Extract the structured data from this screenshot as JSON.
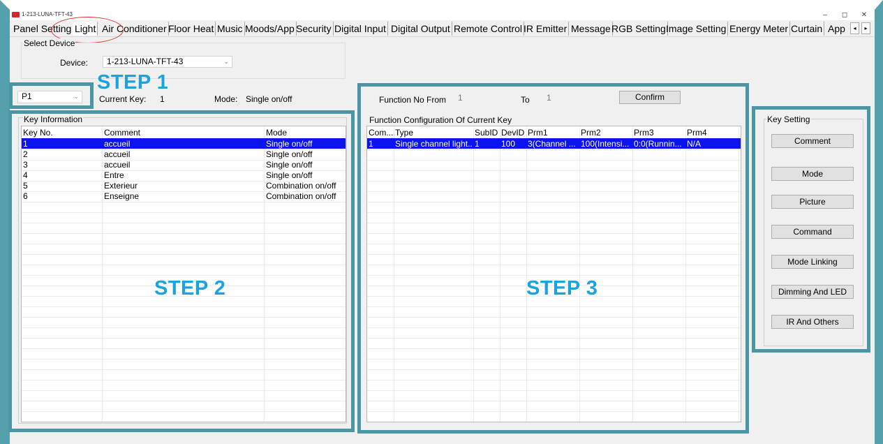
{
  "window": {
    "title": "1-213-LUNA-TFT-43",
    "minimize": "–",
    "maximize": "◻",
    "close": "✕"
  },
  "tabs": [
    "Panel Setting",
    "Light",
    "Air Conditioner",
    "Floor Heat",
    "Music",
    "Moods/App",
    "Security",
    "Digital Input",
    "Digital Output",
    "Remote Control",
    "IR Emitter",
    "Message",
    "RGB Setting",
    "Image Setting",
    "Energy Meter",
    "Curtain",
    "App"
  ],
  "tab_scroll": {
    "left": "◂",
    "right": "▸"
  },
  "select_device": {
    "group_label": "Select Device",
    "device_label": "Device:",
    "device_value": "1-213-LUNA-TFT-43"
  },
  "steps": {
    "step1": "STEP 1",
    "step2": "STEP 2",
    "step3": "STEP 3"
  },
  "page_select": {
    "value": "P1"
  },
  "current_key": {
    "label": "Current Key:",
    "value": "1"
  },
  "mode": {
    "label": "Mode:",
    "value": "Single on/off"
  },
  "key_info": {
    "title": "Key Information",
    "headers": [
      "Key No.",
      "Comment",
      "Mode"
    ],
    "rows": [
      [
        "1",
        "accueil",
        "Single on/off"
      ],
      [
        "2",
        "accueil",
        "Single on/off"
      ],
      [
        "3",
        "accueil",
        "Single on/off"
      ],
      [
        "4",
        "Entre",
        "Single on/off"
      ],
      [
        "5",
        "Exterieur",
        "Combination on/off"
      ],
      [
        "6",
        "Enseigne",
        "Combination on/off"
      ]
    ],
    "selected_row": 0
  },
  "function": {
    "from_label": "Function No From",
    "from_value": "1",
    "to_label": "To",
    "to_value": "1",
    "confirm": "Confirm",
    "config_title": "Function Configuration Of Current Key",
    "headers": [
      "Com...",
      "Type",
      "SubID",
      "DevID",
      "Prm1",
      "Prm2",
      "Prm3",
      "Prm4"
    ],
    "rows": [
      [
        "1",
        "Single channel light...",
        "1",
        "100",
        "3(Channel ...",
        "100(Intensi...",
        "0:0(Runnin...",
        "N/A"
      ]
    ]
  },
  "key_setting": {
    "title": "Key Setting",
    "buttons": [
      "Comment",
      "Mode",
      "Picture",
      "Command",
      "Mode Linking",
      "Dimming And LED",
      "IR And Others"
    ]
  },
  "colors": {
    "teal": "#4b96a4",
    "step_blue": "#1aa3df",
    "selection": "#0a13f0",
    "circle_red": "#d9332d"
  }
}
